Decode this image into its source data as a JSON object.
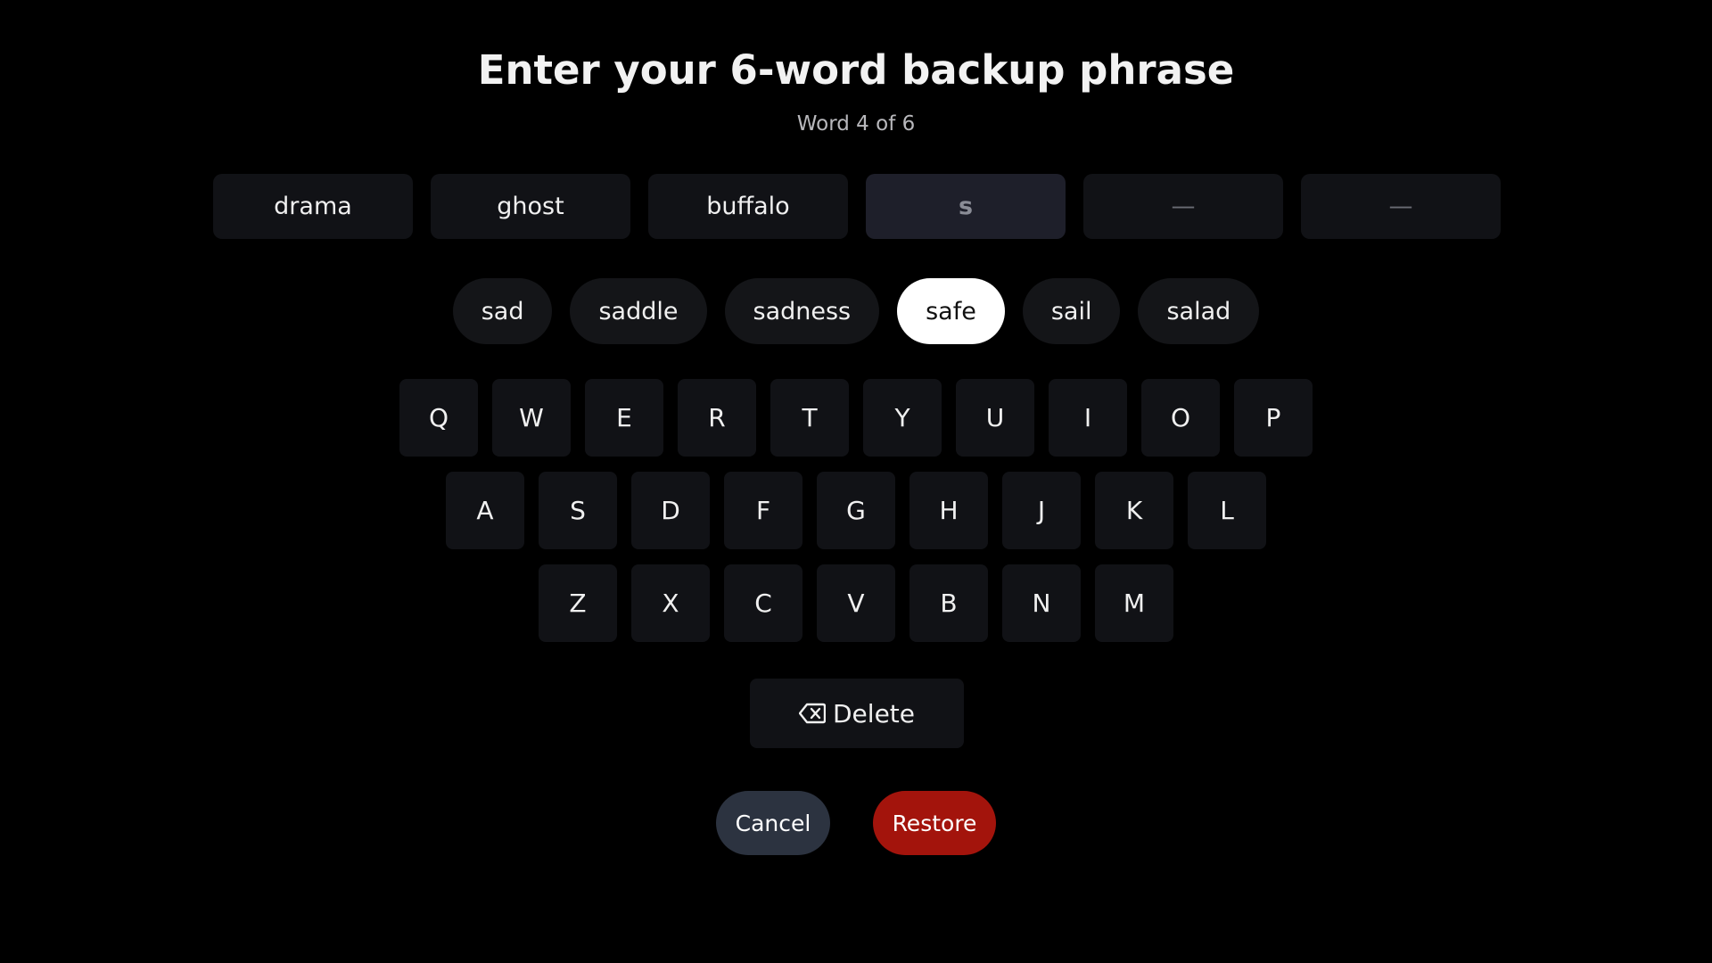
{
  "header": {
    "title": "Enter your 6-word backup phrase",
    "subtitle": "Word 4 of 6"
  },
  "word_slots": [
    {
      "text": "drama",
      "state": "filled"
    },
    {
      "text": "ghost",
      "state": "filled"
    },
    {
      "text": "buffalo",
      "state": "filled"
    },
    {
      "text": "s",
      "state": "active"
    },
    {
      "text": "—",
      "state": "empty"
    },
    {
      "text": "—",
      "state": "empty"
    }
  ],
  "suggestions": [
    {
      "text": "sad",
      "selected": false
    },
    {
      "text": "saddle",
      "selected": false
    },
    {
      "text": "sadness",
      "selected": false
    },
    {
      "text": "safe",
      "selected": true
    },
    {
      "text": "sail",
      "selected": false
    },
    {
      "text": "salad",
      "selected": false
    }
  ],
  "keyboard": {
    "rows": [
      [
        "Q",
        "W",
        "E",
        "R",
        "T",
        "Y",
        "U",
        "I",
        "O",
        "P"
      ],
      [
        "A",
        "S",
        "D",
        "F",
        "G",
        "H",
        "J",
        "K",
        "L"
      ],
      [
        "Z",
        "X",
        "C",
        "V",
        "B",
        "N",
        "M"
      ]
    ],
    "delete_label": "Delete",
    "delete_icon": "backspace-icon"
  },
  "actions": {
    "cancel_label": "Cancel",
    "restore_label": "Restore"
  },
  "colors": {
    "background": "#000000",
    "key": "#111216",
    "active_slot": "#1e1f2a",
    "selected_chip": "#ffffff",
    "cancel": "#2c3340",
    "restore": "#a3140c"
  }
}
